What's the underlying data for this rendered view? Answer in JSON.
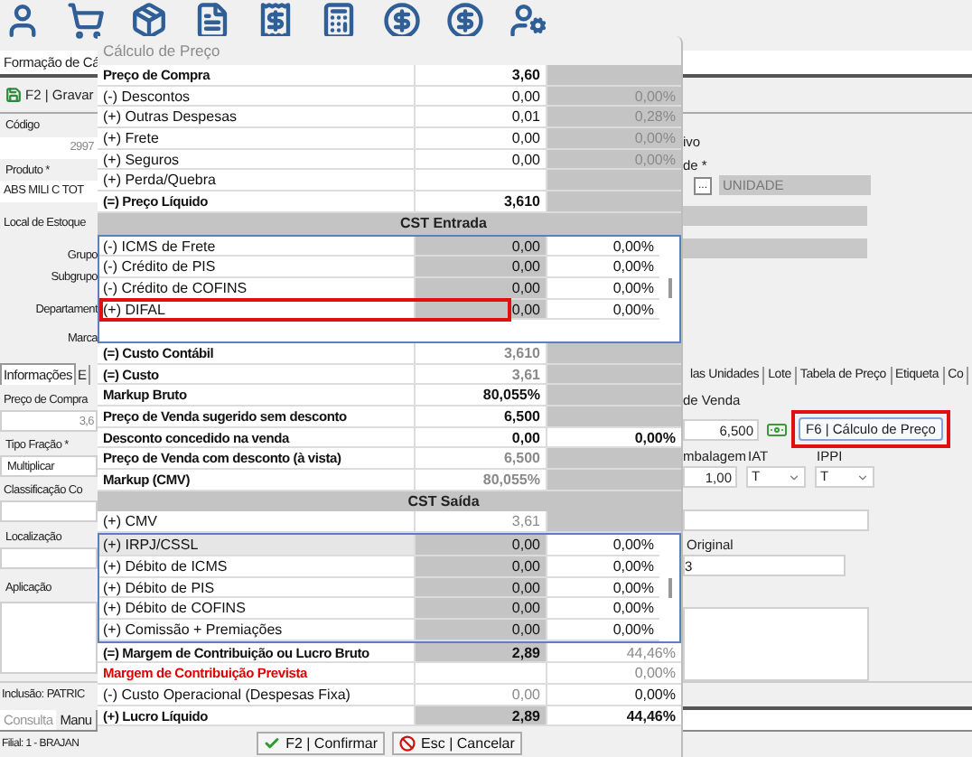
{
  "app": {
    "document_tab": "Formação de Cá",
    "save_button": "F2 | Gravar",
    "form_left": {
      "codigo_label": "Código",
      "codigo_value": "2997",
      "produto_label": "Produto *",
      "produto_value": "ABS MILI C TOT",
      "local_label": "Local de Estoque",
      "grupo_label": "Grupo",
      "subgrupo_label": "Subgrupo",
      "departamento_label": "Departament",
      "marca_label": "Marca"
    },
    "form_right": {
      "label_1": "ivo",
      "label_2": "de *",
      "lookup_button": "...",
      "unidade_value": "UNIDADE"
    },
    "section_tabs_left": [
      {
        "label": "Informações",
        "selected": true
      },
      {
        "label": "E",
        "selected": false
      }
    ],
    "section_tabs_right": [
      {
        "label": "las Unidades",
        "selected": false
      },
      {
        "label": "Lote",
        "selected": false
      },
      {
        "label": "Tabela de Preço",
        "selected": false
      },
      {
        "label": "Etiqueta",
        "selected": false
      },
      {
        "label": "Co",
        "selected": false
      }
    ],
    "info_left": {
      "preco_compra_label": "Preço de Compra",
      "preco_compra_value": "3,6",
      "tipo_fracao_label": "Tipo Fração *",
      "tipo_fracao_value": "Multiplicar",
      "classificacao_label": "Classificação Co",
      "localizacao_label": "Localização",
      "aplicacao_label": "Aplicação"
    },
    "info_right": {
      "preco_venda_label": "de Venda",
      "preco_venda_value": "6,500",
      "calc_button": {
        "label": "F6 | Cálculo de Preço",
        "highlighted": true
      },
      "embalagem_label": "mbalagem",
      "embalagem_value": "1,00",
      "iat_label": "IAT",
      "iat_value": "T",
      "ippi_label": "IPPI",
      "ippi_value": "T",
      "original_label": "Original",
      "original_value": "3"
    },
    "status": "Inclusão: PATRIC",
    "bottom_tabs": [
      {
        "label": "Consulta",
        "selected": true
      },
      {
        "label": "Manu",
        "selected": false
      }
    ],
    "footer": "Filial: 1 - BRAJAN"
  },
  "dialog": {
    "title": "Cálculo de Preço",
    "items": [
      {
        "kind": "row",
        "label": "Preço de Compra",
        "value": "3,60",
        "bold": true,
        "value_shaded": false,
        "value_dimmed": false,
        "percent_shaded": true,
        "highlighted": false
      },
      {
        "kind": "row",
        "label": "(-) Descontos",
        "value": "0,00",
        "percent": "0,00%",
        "bold": false,
        "value_shaded": false,
        "value_dimmed": false,
        "percent_shaded": true,
        "percent_dimmed": true,
        "highlighted": false
      },
      {
        "kind": "row",
        "label": "(+) Outras Despesas",
        "value": "0,01",
        "percent": "0,28%",
        "bold": false,
        "value_shaded": false,
        "value_dimmed": false,
        "percent_shaded": true,
        "percent_dimmed": true,
        "highlighted": false
      },
      {
        "kind": "row",
        "label": "(+) Frete",
        "value": "0,00",
        "percent": "0,00%",
        "bold": false,
        "value_shaded": false,
        "value_dimmed": false,
        "percent_shaded": true,
        "percent_dimmed": true,
        "highlighted": false
      },
      {
        "kind": "row",
        "label": "(+) Seguros",
        "value": "0,00",
        "percent": "0,00%",
        "bold": false,
        "value_shaded": false,
        "value_dimmed": false,
        "percent_shaded": true,
        "percent_dimmed": true,
        "highlighted": false
      },
      {
        "kind": "row",
        "label": "(+) Perda/Quebra",
        "bold": false,
        "value_shaded": false,
        "percent_shaded": true,
        "highlighted": false
      },
      {
        "kind": "row",
        "label": "(=) Preço Líquido",
        "value": "3,610",
        "bold": true,
        "value_shaded": false,
        "value_dimmed": false,
        "percent_shaded": true,
        "highlighted": false
      },
      {
        "kind": "header",
        "label": "CST Entrada"
      },
      {
        "kind": "group",
        "rows": [
          {
            "label": "(-) ICMS de Frete",
            "value": "0,00",
            "percent": "0,00%",
            "selected": false,
            "highlighted": false
          },
          {
            "label": "(-) Crédito de PIS",
            "value": "0,00",
            "percent": "0,00%",
            "selected": false,
            "highlighted": false
          },
          {
            "label": "(-) Crédito de COFINS",
            "value": "0,00",
            "percent": "0,00%",
            "selected": false,
            "highlighted": false
          },
          {
            "label": "(+) DIFAL",
            "value": "0,00",
            "percent": "0,00%",
            "selected": false,
            "highlighted": true
          }
        ]
      },
      {
        "kind": "row",
        "label": "(=) Custo Contábil",
        "value": "3,610",
        "bold": true,
        "value_shaded": false,
        "value_dimmed": true,
        "percent_shaded": true,
        "highlighted": false
      },
      {
        "kind": "row",
        "label": "(=) Custo",
        "value": "3,61",
        "bold": true,
        "value_shaded": false,
        "value_dimmed": true,
        "percent_shaded": true,
        "highlighted": false
      },
      {
        "kind": "row",
        "label": "Markup Bruto",
        "value": "80,055%",
        "bold": true,
        "value_shaded": false,
        "value_dimmed": false,
        "percent_shaded": true,
        "highlighted": false
      },
      {
        "kind": "row",
        "label": "Preço de Venda sugerido sem desconto",
        "value": "6,500",
        "bold": true,
        "value_shaded": false,
        "value_dimmed": false,
        "percent_shaded": true,
        "highlighted": false
      },
      {
        "kind": "row",
        "label": "Desconto concedido na venda",
        "value": "0,00",
        "percent": "0,00%",
        "bold": true,
        "value_shaded": false,
        "value_dimmed": false,
        "percent_shaded": false,
        "percent_dimmed": false,
        "highlighted": false
      },
      {
        "kind": "row",
        "label": "Preço de Venda com desconto (à vista)",
        "value": "6,500",
        "bold": true,
        "value_shaded": false,
        "value_dimmed": true,
        "percent_shaded": true,
        "highlighted": false
      },
      {
        "kind": "row",
        "label": "Markup (CMV)",
        "value": "80,055%",
        "bold": true,
        "value_shaded": false,
        "value_dimmed": true,
        "percent_shaded": true,
        "highlighted": false
      },
      {
        "kind": "header",
        "label": "CST Saída"
      },
      {
        "kind": "row",
        "label": "(+) CMV",
        "value": "3,61",
        "bold": false,
        "value_shaded": false,
        "value_dimmed": true,
        "percent_shaded": true,
        "highlighted": false
      },
      {
        "kind": "group",
        "rows": [
          {
            "label": "(+) IRPJ/CSSL",
            "value": "0,00",
            "percent": "0,00%",
            "selected": true,
            "highlighted": false
          },
          {
            "label": "(+) Débito de ICMS",
            "value": "0,00",
            "percent": "0,00%",
            "selected": false,
            "highlighted": false
          },
          {
            "label": "(+) Débito de PIS",
            "value": "0,00",
            "percent": "0,00%",
            "selected": false,
            "highlighted": false
          },
          {
            "label": "(+) Débito de COFINS",
            "value": "0,00",
            "percent": "0,00%",
            "selected": false,
            "highlighted": false
          },
          {
            "label": "(+) Comissão + Premiações",
            "value": "0,00",
            "percent": "0,00%",
            "selected": false,
            "highlighted": false
          }
        ]
      },
      {
        "kind": "row",
        "label": "(=) Margem de Contribuição ou Lucro Bruto",
        "value": "2,89",
        "percent": "44,46%",
        "bold": true,
        "value_shaded": true,
        "value_dimmed": false,
        "percent_shaded": false,
        "percent_dimmed": true,
        "highlighted": false
      },
      {
        "kind": "row",
        "label": "Margem de Contribuição Prevista",
        "percent": "0,00%",
        "bold": true,
        "alert": true,
        "value_shaded": false,
        "percent_shaded": false,
        "percent_dimmed": true,
        "highlighted": false
      },
      {
        "kind": "row",
        "label": "(-) Custo Operacional (Despesas Fixa)",
        "value": "0,00",
        "percent": "0,00%",
        "bold": false,
        "value_shaded": false,
        "value_dimmed": true,
        "percent_shaded": false,
        "percent_dimmed": false,
        "highlighted": false
      },
      {
        "kind": "row",
        "label": "(+) Lucro Líquido",
        "value": "2,89",
        "percent": "44,46%",
        "bold": true,
        "value_shaded": true,
        "value_dimmed": false,
        "percent_shaded": false,
        "percent_dimmed": false,
        "highlighted": false
      }
    ],
    "buttons": [
      {
        "kind": "confirm",
        "label": "F2 | Confirmar"
      },
      {
        "kind": "cancel",
        "label": "Esc | Cancelar"
      }
    ]
  }
}
